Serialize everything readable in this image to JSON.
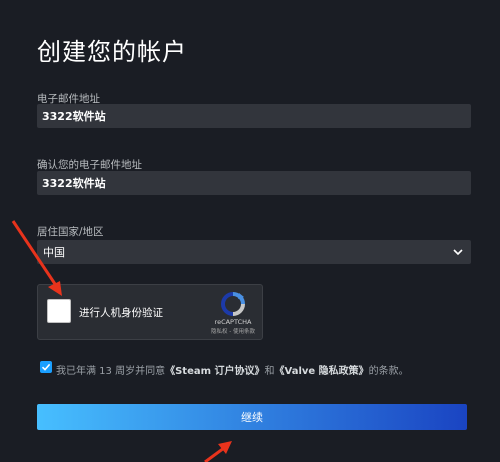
{
  "title": "创建您的帐户",
  "email": {
    "label": "电子邮件地址",
    "value": "3322软件站"
  },
  "confirm_email": {
    "label": "确认您的电子邮件地址",
    "value": "3322软件站"
  },
  "country": {
    "label": "居住国家/地区",
    "selected": "中国"
  },
  "captcha": {
    "label": "进行人机身份验证",
    "brand": "reCAPTCHA",
    "links": "隐私权 - 使用条款",
    "checked": false
  },
  "agreement": {
    "checked": true,
    "prefix": "我已年满 13 周岁并同意",
    "steam_link": "《Steam 订户协议》",
    "and": "和",
    "valve_link": "《Valve 隐私政策》",
    "suffix": "的条款。"
  },
  "continue_label": "继续",
  "colors": {
    "background": "#1a1d24",
    "field": "#32353c",
    "accent_start": "#47bfff",
    "accent_end": "#1a44c2",
    "annotation": "#e8331c"
  },
  "icons": [
    "chevron-down-icon",
    "recaptcha-logo-icon",
    "checkbox-checked-icon",
    "annotation-arrow-icon"
  ]
}
